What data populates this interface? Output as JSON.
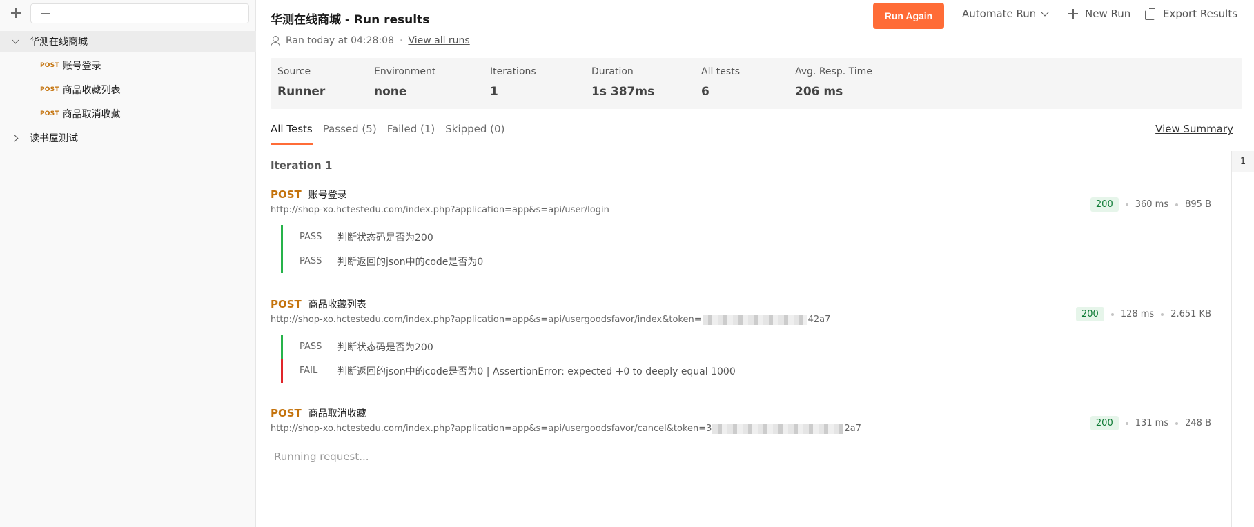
{
  "sidebar": {
    "collection": {
      "name": "华测在线商城"
    },
    "requests": [
      {
        "method": "POST",
        "name": "账号登录"
      },
      {
        "method": "POST",
        "name": "商品收藏列表"
      },
      {
        "method": "POST",
        "name": "商品取消收藏"
      }
    ],
    "other_collection": {
      "name": "读书屋测试"
    }
  },
  "header": {
    "title": "华测在线商城 - Run results",
    "ran_text": "Ran today at 04:28:08",
    "view_all_runs": "View all runs",
    "run_again": "Run Again",
    "automate_run": "Automate Run",
    "new_run": "New Run",
    "export_results": "Export Results"
  },
  "summary": [
    {
      "label": "Source",
      "value": "Runner"
    },
    {
      "label": "Environment",
      "value": "none"
    },
    {
      "label": "Iterations",
      "value": "1"
    },
    {
      "label": "Duration",
      "value": "1s 387ms"
    },
    {
      "label": "All tests",
      "value": "6"
    },
    {
      "label": "Avg. Resp. Time",
      "value": "206 ms"
    }
  ],
  "tabs": [
    "All Tests",
    "Passed (5)",
    "Failed (1)",
    "Skipped (0)"
  ],
  "view_summary": "View Summary",
  "iteration": {
    "label": "Iteration 1",
    "number": "1"
  },
  "results": [
    {
      "method": "POST",
      "name": "账号登录",
      "url_prefix": "http://shop-xo.hctestedu.com/index.php?application=app&s=api/user/login",
      "url_suffix": "",
      "status": "200",
      "time": "360 ms",
      "size": "895 B",
      "tests": [
        {
          "status": "PASS",
          "text": "判断状态码是否为200"
        },
        {
          "status": "PASS",
          "text": "判断返回的json中的code是否为0"
        }
      ]
    },
    {
      "method": "POST",
      "name": "商品收藏列表",
      "url_prefix": "http://shop-xo.hctestedu.com/index.php?application=app&s=api/usergoodsfavor/index&token=",
      "url_suffix": "42a7",
      "status": "200",
      "time": "128 ms",
      "size": "2.651 KB",
      "tests": [
        {
          "status": "PASS",
          "text": "判断状态码是否为200"
        },
        {
          "status": "FAIL",
          "text": "判断返回的json中的code是否为0 | AssertionError: expected +0 to deeply equal 1000"
        }
      ]
    },
    {
      "method": "POST",
      "name": "商品取消收藏",
      "url_prefix": "http://shop-xo.hctestedu.com/index.php?application=app&s=api/usergoodsfavor/cancel&token=3",
      "url_suffix": "2a7",
      "status": "200",
      "time": "131 ms",
      "size": "248 B",
      "tests": []
    }
  ],
  "running_text": "Running request..."
}
